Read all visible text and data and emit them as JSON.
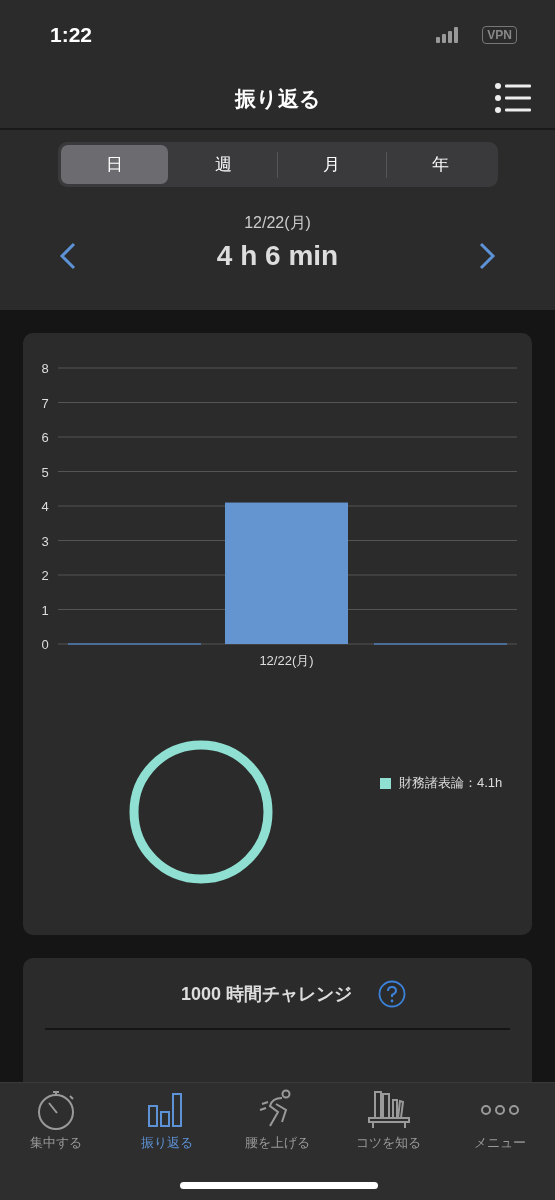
{
  "status_bar": {
    "time": "1:22",
    "vpn": "VPN"
  },
  "header": {
    "title": "振り返る"
  },
  "period_tabs": [
    {
      "label": "日",
      "selected": true
    },
    {
      "label": "週",
      "selected": false
    },
    {
      "label": "月",
      "selected": false
    },
    {
      "label": "年",
      "selected": false
    }
  ],
  "date": "12/22(月)",
  "total": "4 h 6 min",
  "bar_chart": {
    "chart_data": {
      "type": "bar",
      "categories": [
        "12/22(月)"
      ],
      "values": [
        4.1
      ],
      "ylim": [
        0,
        8
      ],
      "yticks": [
        0,
        1,
        2,
        3,
        4,
        5,
        6,
        7,
        8
      ],
      "grid": true
    }
  },
  "donut_chart": {
    "legend": [
      {
        "label": "財務諸表論：4.1h",
        "color": "#8fe0d2"
      }
    ]
  },
  "challenge": {
    "title": "1000 時間チャレンジ"
  },
  "bottom_tabs": [
    {
      "label": "集中する",
      "kind": "stopwatch",
      "selected": false
    },
    {
      "label": "振り返る",
      "kind": "bars",
      "selected": true
    },
    {
      "label": "腰を上げる",
      "kind": "runner",
      "selected": false
    },
    {
      "label": "コツを知る",
      "kind": "books",
      "selected": false
    },
    {
      "label": "メニュー",
      "kind": "dots",
      "selected": false
    }
  ]
}
